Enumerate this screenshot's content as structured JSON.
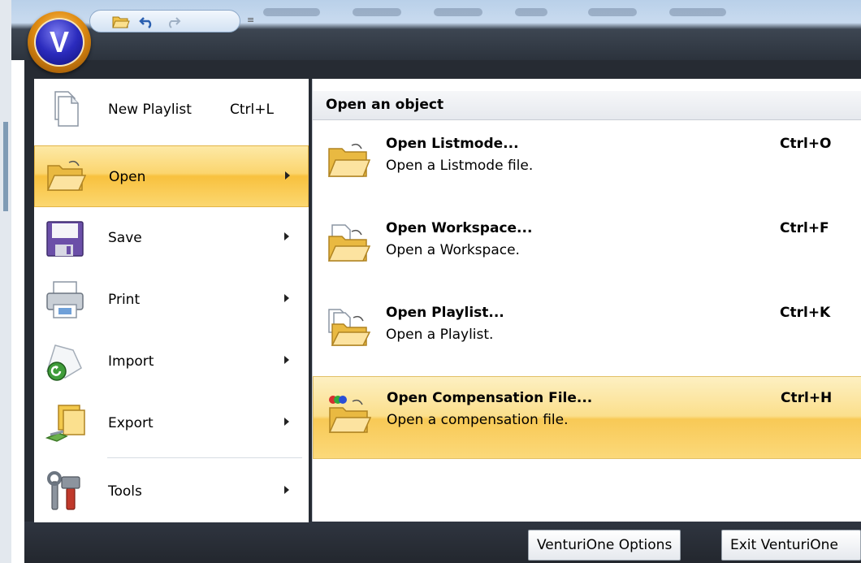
{
  "app": {
    "logo_letter": "V",
    "brand_color": "#2b2bbd",
    "accent_color": "#f8c13e"
  },
  "quick_access": {
    "buttons": [
      {
        "name": "open-folder-icon"
      },
      {
        "name": "undo-icon"
      },
      {
        "name": "redo-icon"
      }
    ],
    "dropdown_glyph": "≡"
  },
  "left_menu": {
    "items": [
      {
        "label": "New Playlist",
        "shortcut": "Ctrl+L",
        "icon": "new-document-icon",
        "submenu": false
      },
      {
        "label": "Open",
        "shortcut": "",
        "icon": "open-folder-icon",
        "submenu": true,
        "selected": true
      },
      {
        "label": "Save",
        "shortcut": "",
        "icon": "save-floppy-icon",
        "submenu": true
      },
      {
        "label": "Print",
        "shortcut": "",
        "icon": "printer-icon",
        "submenu": true
      },
      {
        "label": "Import",
        "shortcut": "",
        "icon": "import-icon",
        "submenu": true
      },
      {
        "label": "Export",
        "shortcut": "",
        "icon": "export-icon",
        "submenu": true
      },
      {
        "label": "Tools",
        "shortcut": "",
        "icon": "tools-icon",
        "submenu": true
      }
    ]
  },
  "right_pane": {
    "header": "Open an object",
    "items": [
      {
        "title": "Open Listmode...",
        "description": "Open a Listmode file.",
        "shortcut": "Ctrl+O",
        "icon": "open-listmode-icon"
      },
      {
        "title": "Open Workspace...",
        "description": "Open a Workspace.",
        "shortcut": "Ctrl+F",
        "icon": "open-workspace-icon"
      },
      {
        "title": "Open Playlist...",
        "description": "Open a Playlist.",
        "shortcut": "Ctrl+K",
        "icon": "open-playlist-icon"
      },
      {
        "title": "Open Compensation File...",
        "description": "Open a compensation file.",
        "shortcut": "Ctrl+H",
        "icon": "open-compensation-icon",
        "highlighted": true
      }
    ]
  },
  "footer": {
    "options_label": "VenturiOne Options",
    "exit_label": "Exit VenturiOne"
  }
}
